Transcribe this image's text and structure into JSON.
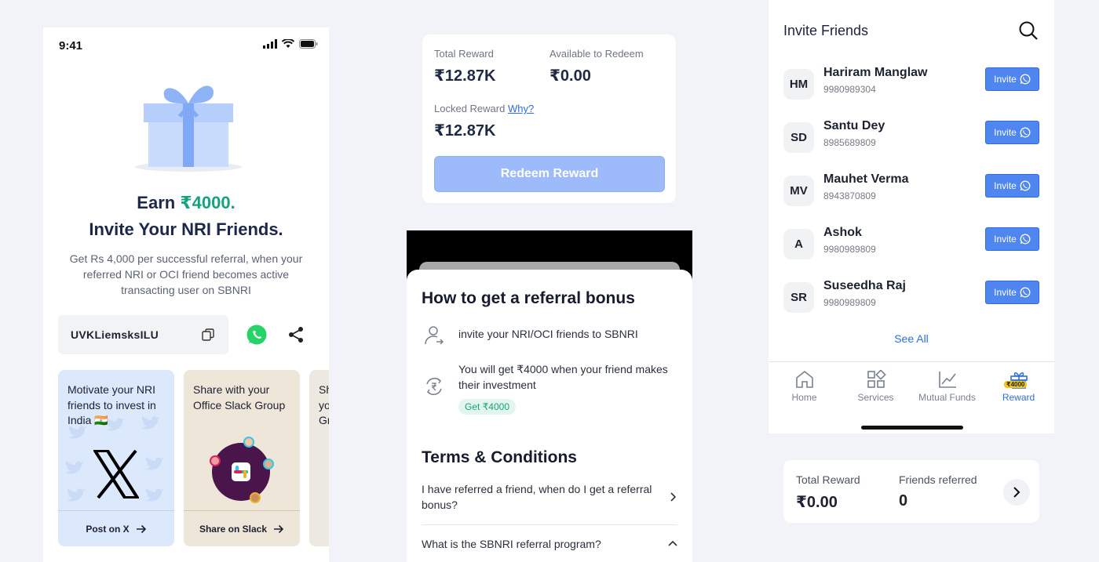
{
  "phone": {
    "status_time": "9:41",
    "earn_prefix": "Earn ",
    "earn_amount": "₹4000.",
    "headline": "Invite Your NRI Friends.",
    "description": "Get Rs 4,000 per successful referral, when your referred NRI or OCI friend becomes active transacting user on SBNRI",
    "referral_code": "UVKLiemsksILU",
    "cards": [
      {
        "title": "Motivate your NRI friends to invest in India 🇮🇳",
        "cta": "Post on X"
      },
      {
        "title": "Share with your Office Slack Group",
        "cta": "Share on Slack"
      },
      {
        "title": "Sh yo Gr"
      }
    ]
  },
  "reward_card": {
    "total_label": "Total Reward",
    "total_value": "₹12.87K",
    "available_label": "Available to Redeem",
    "available_value": "₹0.00",
    "locked_label": "Locked Reward ",
    "locked_why": "Why?",
    "locked_value": "₹12.87K",
    "redeem_button": "Redeem Reward"
  },
  "how_to": {
    "title": "How to get a referral bonus",
    "step1": "invite your NRI/OCI friends to SBNRI",
    "step2": "You will get ₹4000 when your friend makes their investment",
    "badge": "Get ₹4000",
    "terms_title": "Terms & Conditions",
    "faq": [
      "I have referred a friend, when do I get a referral bonus?",
      "What is the SBNRI referral program?"
    ]
  },
  "invite": {
    "title": "Invite Friends",
    "invite_label": "Invite",
    "contacts": [
      {
        "initials": "HM",
        "name": "Hariram Manglaw",
        "phone": "9980989304"
      },
      {
        "initials": "SD",
        "name": "Santu Dey",
        "phone": "8985689809"
      },
      {
        "initials": "MV",
        "name": "Mauhet Verma",
        "phone": "8943870809"
      },
      {
        "initials": "A",
        "name": "Ashok",
        "phone": "9980989809"
      },
      {
        "initials": "SR",
        "name": "Suseedha Raj",
        "phone": "9980989809"
      }
    ],
    "see_all": "See All",
    "tabs": [
      "Home",
      "Services",
      "Mutual Funds",
      "Reward"
    ],
    "reward_badge": "₹4000"
  },
  "summary": {
    "total_label": "Total Reward",
    "total_value": "₹0.00",
    "friends_label": "Friends referred",
    "friends_value": "0"
  },
  "colors": {
    "accent_blue": "#4f86f0",
    "green": "#15a37e",
    "redeem_disabled": "#9dbbfb"
  }
}
